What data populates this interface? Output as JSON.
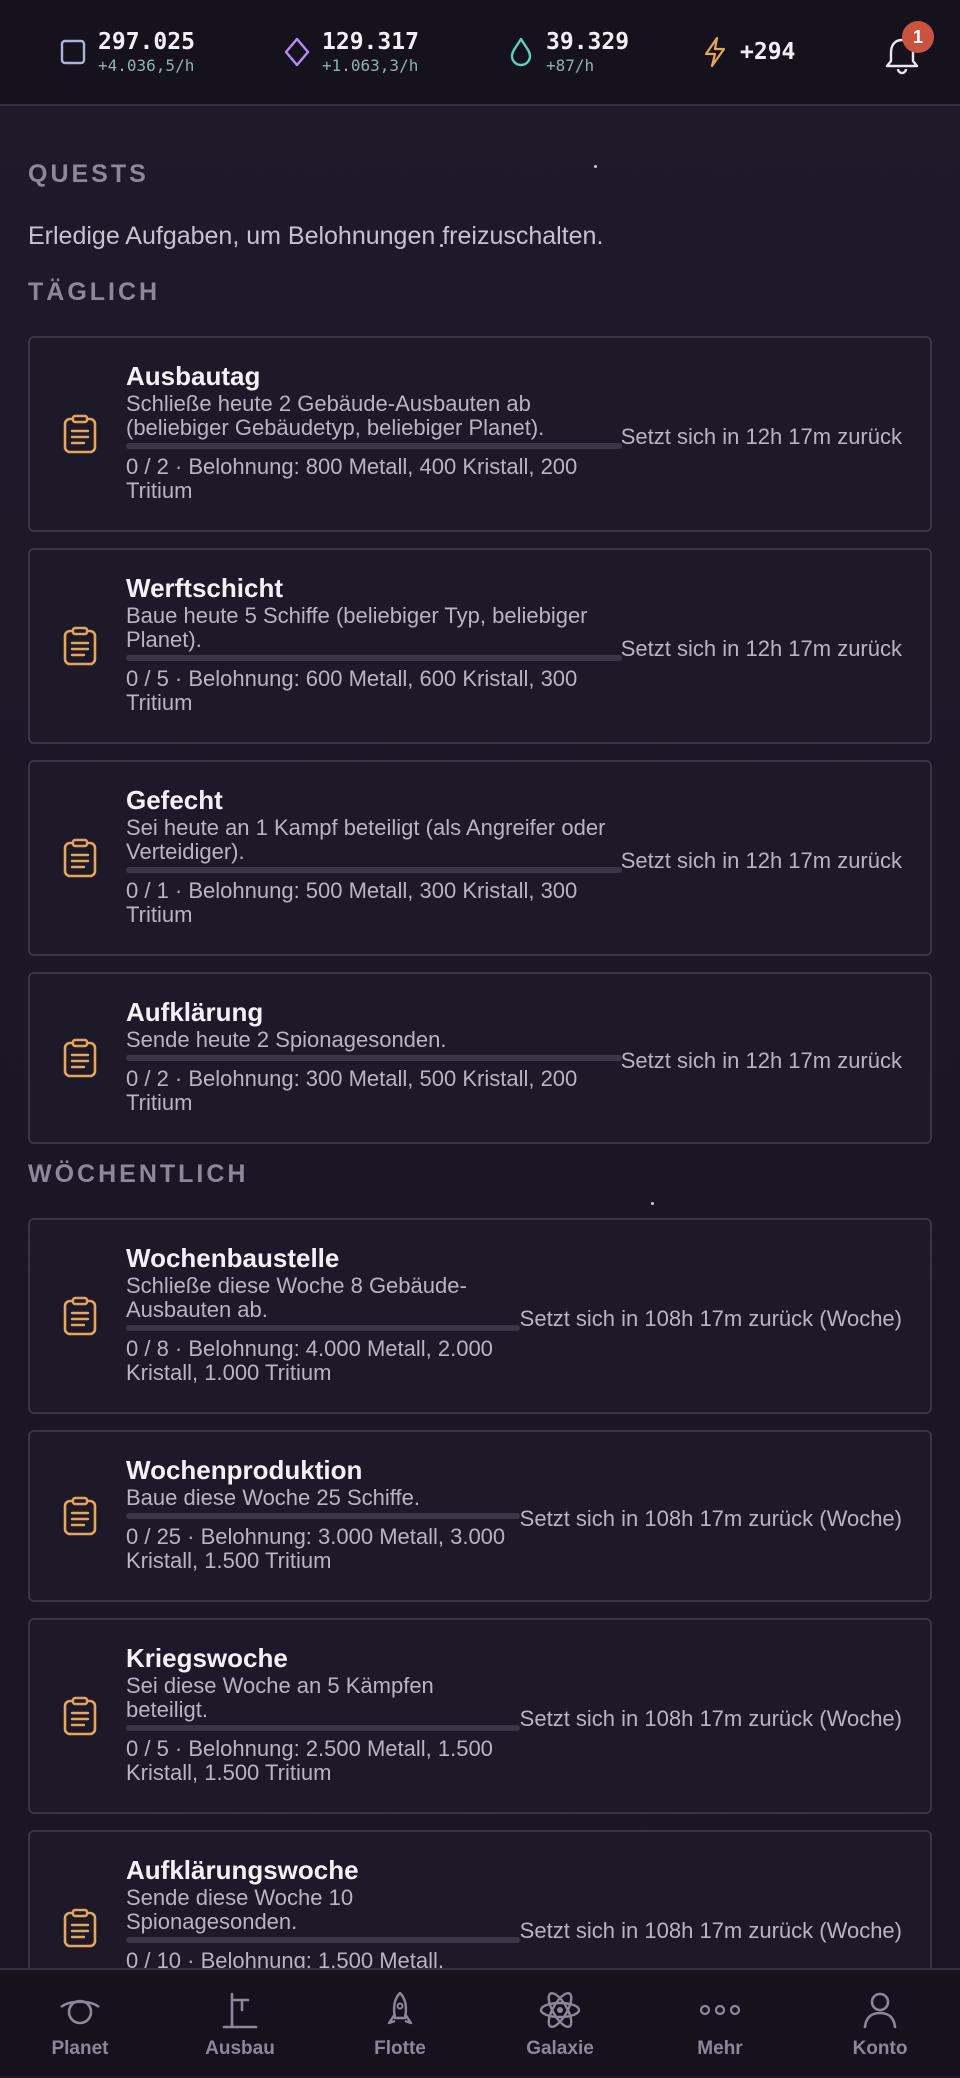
{
  "topbar": {
    "resources": [
      {
        "name": "metal-resource",
        "amount": "297.025",
        "rate": "+4.036,5/h",
        "icon": "square-outline-icon",
        "color": "#a9b4d6"
      },
      {
        "name": "crystal-resource",
        "amount": "129.317",
        "rate": "+1.063,3/h",
        "icon": "diamond-icon",
        "color": "#b58cf2"
      },
      {
        "name": "tritium-resource",
        "amount": "39.329",
        "rate": "+87/h",
        "icon": "droplet-icon",
        "color": "#5fd0b9"
      },
      {
        "name": "energy-resource",
        "amount": "+294",
        "rate": "",
        "icon": "lightning-icon",
        "color": "#e3a65a"
      }
    ],
    "notifications": {
      "count": "1",
      "icon": "bell-icon"
    }
  },
  "page": {
    "title": "QUESTS",
    "subtitle": "Erledige Aufgaben, um Belohnungen freizuschalten."
  },
  "sections": {
    "daily": "TÄGLICH",
    "weekly": "WÖCHENTLICH"
  },
  "daily_quests": [
    {
      "title": "Ausbautag",
      "desc": "Schließe heute 2 Gebäude-Ausbauten ab (beliebiger Gebäudetyp, beliebiger Planet).",
      "progress": "0 / 2 · Belohnung: 800 Metall, 400 Kristall, 200 Tritium",
      "fraction": 0,
      "reset": "Setzt sich in 12h 17m zurück"
    },
    {
      "title": "Werftschicht",
      "desc": "Baue heute 5 Schiffe (beliebiger Typ, beliebiger Planet).",
      "progress": "0 / 5 · Belohnung: 600 Metall, 600 Kristall, 300 Tritium",
      "fraction": 0,
      "reset": "Setzt sich in 12h 17m zurück"
    },
    {
      "title": "Gefecht",
      "desc": "Sei heute an 1 Kampf beteiligt (als Angreifer oder Verteidiger).",
      "progress": "0 / 1 · Belohnung: 500 Metall, 300 Kristall, 300 Tritium",
      "fraction": 0,
      "reset": "Setzt sich in 12h 17m zurück"
    },
    {
      "title": "Aufklärung",
      "desc": "Sende heute 2 Spionagesonden.",
      "progress": "0 / 2 · Belohnung: 300 Metall, 500 Kristall, 200 Tritium",
      "fraction": 0,
      "reset": "Setzt sich in 12h 17m zurück"
    }
  ],
  "weekly_quests": [
    {
      "title": "Wochenbaustelle",
      "desc": "Schließe diese Woche 8 Gebäude-Ausbauten ab.",
      "progress": "0 / 8 · Belohnung: 4.000 Metall, 2.000 Kristall, 1.000 Tritium",
      "fraction": 0,
      "reset": "Setzt sich in 108h 17m zurück (Woche)"
    },
    {
      "title": "Wochenproduktion",
      "desc": "Baue diese Woche 25 Schiffe.",
      "progress": "0 / 25 · Belohnung: 3.000 Metall, 3.000 Kristall, 1.500 Tritium",
      "fraction": 0,
      "reset": "Setzt sich in 108h 17m zurück (Woche)"
    },
    {
      "title": "Kriegswoche",
      "desc": "Sei diese Woche an 5 Kämpfen beteiligt.",
      "progress": "0 / 5 · Belohnung: 2.500 Metall, 1.500 Kristall, 1.500 Tritium",
      "fraction": 0,
      "reset": "Setzt sich in 108h 17m zurück (Woche)"
    },
    {
      "title": "Aufklärungswoche",
      "desc": "Sende diese Woche 10 Spionagesonden.",
      "progress": "0 / 10 · Belohnung: 1.500 Metall,",
      "fraction": 0,
      "reset": "Setzt sich in 108h 17m zurück (Woche)"
    }
  ],
  "bottom_nav": [
    {
      "label": "Planet",
      "icon": "planet-icon"
    },
    {
      "label": "Ausbau",
      "icon": "build-icon"
    },
    {
      "label": "Flotte",
      "icon": "rocket-icon"
    },
    {
      "label": "Galaxie",
      "icon": "atom-icon"
    },
    {
      "label": "Mehr",
      "icon": "more-dots-icon"
    },
    {
      "label": "Konto",
      "icon": "user-icon"
    }
  ],
  "colors": {
    "accent": "#e3a65a",
    "badge": "#c9533f"
  }
}
